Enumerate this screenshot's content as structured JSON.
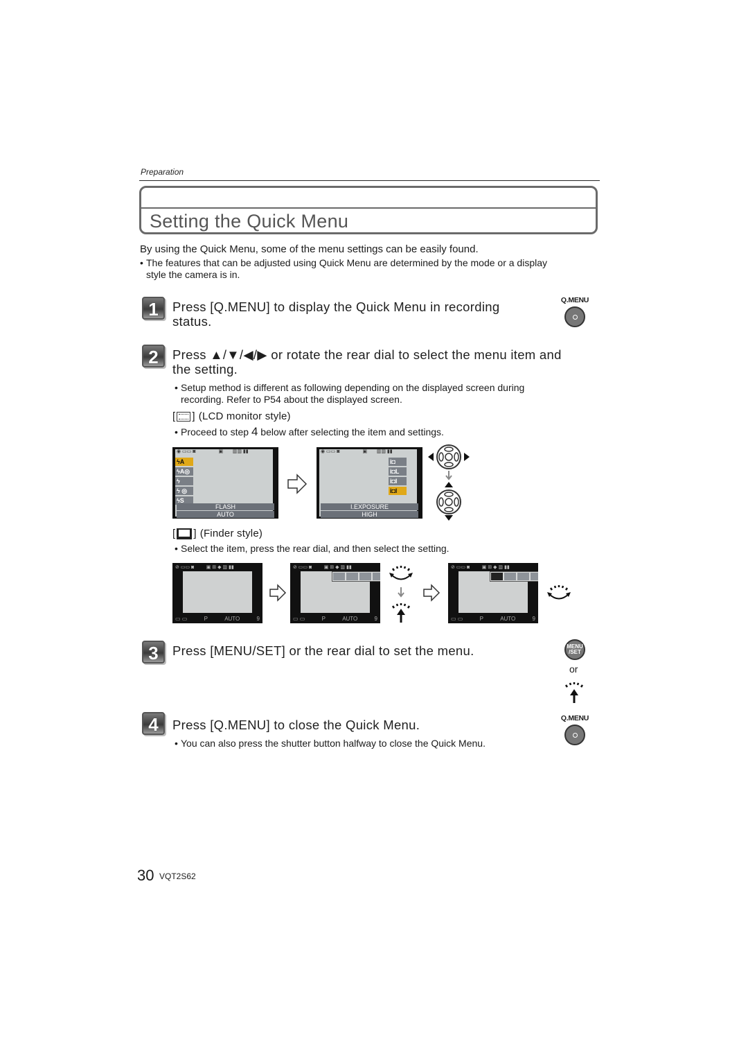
{
  "header": {
    "section": "Preparation"
  },
  "title": "Setting the Quick Menu",
  "intro": {
    "text": "By using the Quick Menu, some of the menu settings can be easily found.",
    "bullet_line1": "The features that can be adjusted using Quick Menu are determined by the mode or a display",
    "bullet_line2": "style the camera is in."
  },
  "steps": [
    {
      "number": "1",
      "line1": "Press [Q.MENU] to display the Quick Menu in recording",
      "line2": "status.",
      "button_label": "Q.MENU"
    },
    {
      "number": "2",
      "line1": "Press ▲/▼/◀/▶ or rotate the rear dial to select the menu item and",
      "line2": "the setting.",
      "bullet_line1": "Setup method is different as following depending on the displayed screen during",
      "bullet_line2": "recording. Refer to P54 about the displayed screen.",
      "lcd_style": {
        "heading": "(LCD monitor style)",
        "bullet_pre": "Proceed to step ",
        "bullet_step": "4",
        "bullet_post": " below after selecting the item and settings.",
        "screen1": {
          "menu_items": [
            "ϟA",
            "ϟA◎",
            "ϟ",
            "ϟ ◎",
            "ϟS"
          ],
          "selected_index": 0,
          "bar_title": "FLASH",
          "bar_value": "AUTO"
        },
        "screen2": {
          "menu_items": [
            "i◘",
            "i◘L",
            "i◘I",
            "i◘l"
          ],
          "selected_index": 3,
          "bar_title": "I.EXPOSURE",
          "bar_value": "HIGH"
        }
      },
      "finder_style": {
        "heading": "(Finder style)",
        "bullet": "Select the item, press the rear dial, and then select the setting.",
        "bottom_mode": "P",
        "bottom_iso": "AUTO",
        "bottom_count": "9"
      }
    },
    {
      "number": "3",
      "line1": "Press [MENU/SET] or the rear dial to set the menu.",
      "button_label_top": "MENU",
      "button_label_bottom": "/SET",
      "or_text": "or"
    },
    {
      "number": "4",
      "line1": "Press [Q.MENU] to close the Quick Menu.",
      "bullet": "You can also press the shutter button halfway to close the Quick Menu.",
      "button_label": "Q.MENU"
    }
  ],
  "footer": {
    "page": "30",
    "code": "VQT2S62"
  }
}
